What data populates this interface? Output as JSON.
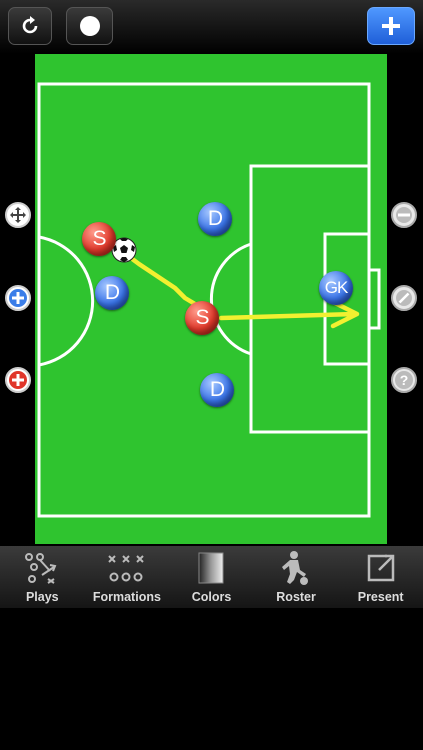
{
  "toolbar": {
    "undo_icon": "undo-icon",
    "record_icon": "record-dot-icon",
    "add_icon": "plus-icon",
    "accent": "#2f7cf6"
  },
  "side_controls": {
    "left": [
      "move-icon",
      "add-blue-player-icon",
      "add-red-player-icon"
    ],
    "right": [
      "minus-icon",
      "pencil-icon",
      "help-icon"
    ]
  },
  "field": {
    "color": "#2fc42f",
    "players": [
      {
        "team": "red",
        "label": "S"
      },
      {
        "team": "red",
        "label": "S"
      },
      {
        "team": "blue",
        "label": "D"
      },
      {
        "team": "blue",
        "label": "D"
      },
      {
        "team": "blue",
        "label": "D"
      },
      {
        "team": "blue",
        "label": "GK"
      }
    ],
    "arrow_color": "#f2f030"
  },
  "tabs": [
    {
      "label": "Plays",
      "icon": "plays-icon"
    },
    {
      "label": "Formations",
      "icon": "formations-icon"
    },
    {
      "label": "Colors",
      "icon": "colors-icon"
    },
    {
      "label": "Roster",
      "icon": "roster-icon"
    },
    {
      "label": "Present",
      "icon": "present-icon"
    }
  ]
}
